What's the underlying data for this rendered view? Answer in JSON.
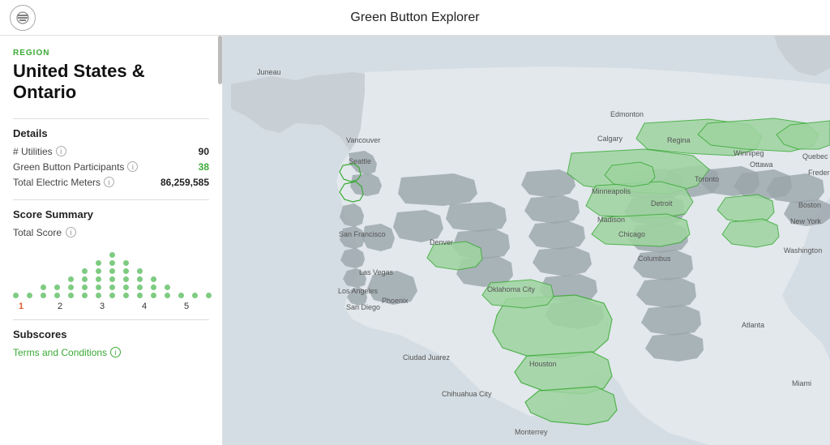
{
  "header": {
    "title": "Green Button Explorer",
    "menu_icon": "menu"
  },
  "sidebar": {
    "region_label": "REGION",
    "region_name": "United States & Ontario",
    "details_title": "Details",
    "details_rows": [
      {
        "label": "# Utilities",
        "value": "90",
        "green": false
      },
      {
        "label": "Green Button Participants",
        "value": "38",
        "green": true
      },
      {
        "label": "Total Electric Meters",
        "value": "86,259,585",
        "green": false
      }
    ],
    "score_title": "Score Summary",
    "score_row_label": "Total Score",
    "dot_columns": [
      1,
      2,
      3,
      4,
      5,
      6,
      7,
      8,
      9,
      10,
      11,
      12,
      13,
      14,
      15
    ],
    "axis_labels": [
      "1",
      "2",
      "3",
      "4",
      "5"
    ],
    "active_axis": "1",
    "subscores_title": "Subscores",
    "terms_label": "Terms and Conditions"
  },
  "map": {
    "city_labels": [
      "Juneau",
      "Edmonton",
      "Calgary",
      "Regina",
      "Winnipeg",
      "Vancouver",
      "Seattle",
      "San Francisco",
      "Las Vegas",
      "Los Angeles",
      "San Diego",
      "Phoenix",
      "Denver",
      "Oklahoma City",
      "Houston",
      "Monterrey",
      "Chihuahua City",
      "Ciudad Juarez",
      "Minneapolis",
      "Chicago",
      "Madison",
      "Columbus",
      "Detroit",
      "Toronto",
      "Ottawa",
      "Quebec",
      "Fredericton",
      "Boston",
      "New York",
      "Washington",
      "Atlanta",
      "Miami"
    ]
  }
}
